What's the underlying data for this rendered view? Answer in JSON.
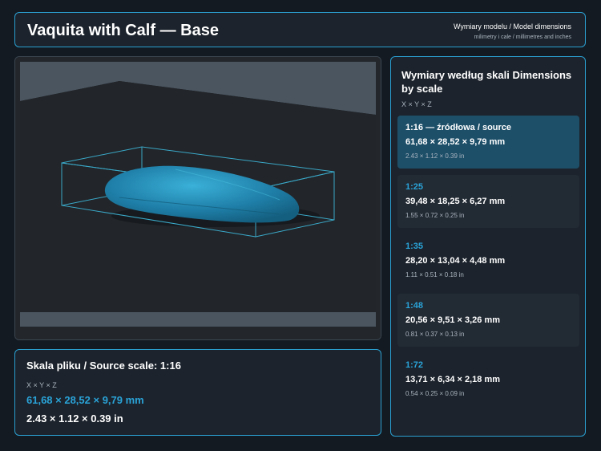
{
  "header": {
    "title": "Vaquita with Calf — Base",
    "subtitle": "Wymiary modelu / Model dimensions",
    "subtitle2": "milimetry i cale / millimetres and inches"
  },
  "viewport": {
    "model_color": "#2a8fb8",
    "bbox_color": "#3aa8c8"
  },
  "source": {
    "title": "Skala pliku / Source scale: 1:16",
    "axes": "X × Y × Z",
    "mm": "61,68 × 28,52 × 9,79 mm",
    "inches": "2.43 × 1.12 × 0.39 in"
  },
  "scales": {
    "title": "Wymiary według skali Dimensions by scale",
    "axes": "X × Y × Z",
    "items": [
      {
        "label": "1:16  —  źródłowa / source",
        "mm": "61,68 × 28,52 × 9,79 mm",
        "inches": "2.43 × 1.12 × 0.39 in",
        "active": true
      },
      {
        "label": "1:25",
        "mm": "39,48 × 18,25 × 6,27 mm",
        "inches": "1.55 × 0.72 × 0.25 in"
      },
      {
        "label": "1:35",
        "mm": "28,20 × 13,04 × 4,48 mm",
        "inches": "1.11 × 0.51 × 0.18 in"
      },
      {
        "label": "1:48",
        "mm": "20,56 × 9,51 × 3,26 mm",
        "inches": "0.81 × 0.37 × 0.13 in"
      },
      {
        "label": "1:72",
        "mm": "13,71 × 6,34 × 2,18 mm",
        "inches": "0.54 × 0.25 × 0.09 in"
      }
    ]
  }
}
